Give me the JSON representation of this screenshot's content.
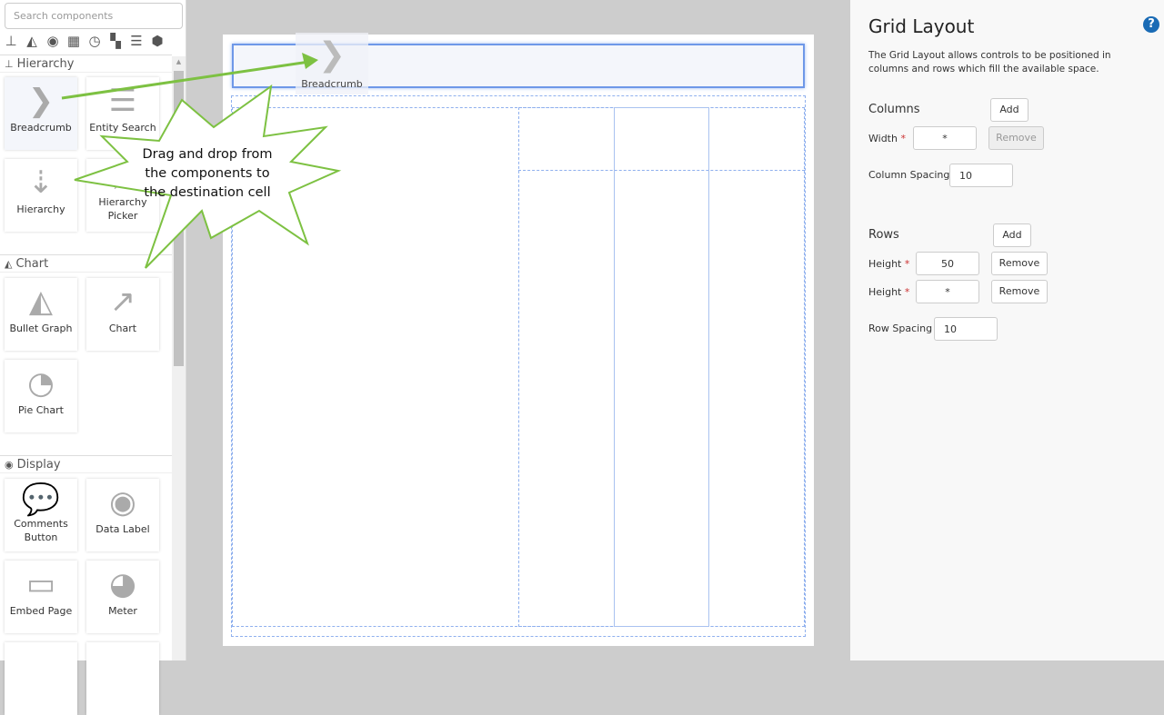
{
  "sidebar": {
    "search_placeholder": "Search components",
    "categories": [
      "hierarchy",
      "chart",
      "display",
      "table",
      "time",
      "layout",
      "filter",
      "other"
    ],
    "sections": [
      {
        "title": "Hierarchy",
        "items": [
          "Breadcrumb",
          "Entity Search",
          "Hierarchy",
          "Hierarchy Picker"
        ]
      },
      {
        "title": "Chart",
        "items": [
          "Bullet Graph",
          "Chart",
          "Pie Chart"
        ]
      },
      {
        "title": "Display",
        "items": [
          "Comments Button",
          "Data Label",
          "Embed Page",
          "Meter"
        ]
      }
    ]
  },
  "canvas": {
    "drag_ghost_label": "Breadcrumb"
  },
  "callout": {
    "lines": [
      "Drag and drop from",
      "the components to",
      "the destination cell"
    ]
  },
  "panel": {
    "title": "Grid Layout",
    "description": "The Grid Layout allows controls to be positioned in columns and rows which fill the available space.",
    "columns": {
      "title": "Columns",
      "add": "Add",
      "width_label": "Width",
      "width_value": "*",
      "remove": "Remove",
      "spacing_label": "Column Spacing",
      "spacing_value": "10"
    },
    "rows": {
      "title": "Rows",
      "add": "Add",
      "items": [
        {
          "label": "Height",
          "value": "50",
          "remove": "Remove"
        },
        {
          "label": "Height",
          "value": "*",
          "remove": "Remove"
        }
      ],
      "spacing_label": "Row Spacing",
      "spacing_value": "10"
    },
    "required_mark": "*"
  }
}
